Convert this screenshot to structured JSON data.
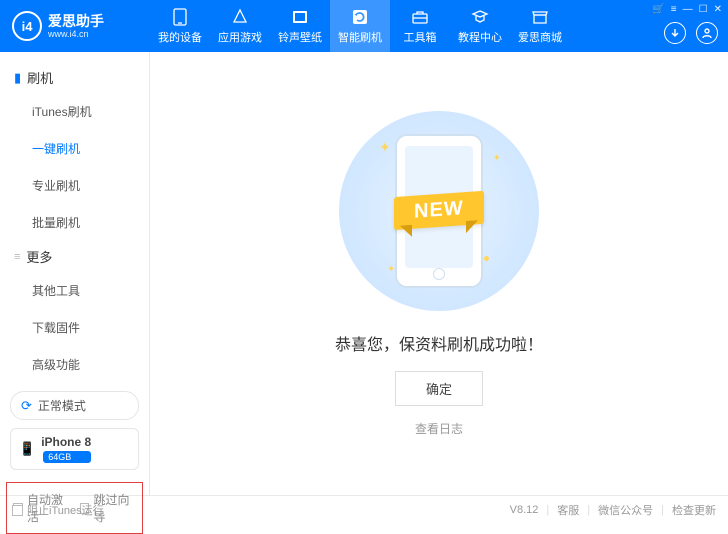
{
  "logo": {
    "badge": "i4",
    "title": "爱思助手",
    "subtitle": "www.i4.cn"
  },
  "nav": [
    {
      "label": "我的设备"
    },
    {
      "label": "应用游戏"
    },
    {
      "label": "铃声壁纸"
    },
    {
      "label": "智能刷机"
    },
    {
      "label": "工具箱"
    },
    {
      "label": "教程中心"
    },
    {
      "label": "爱思商城"
    }
  ],
  "sidebar": {
    "group1": {
      "title": "刷机",
      "items": [
        "iTunes刷机",
        "一键刷机",
        "专业刷机",
        "批量刷机"
      ]
    },
    "group2": {
      "title": "更多",
      "items": [
        "其他工具",
        "下载固件",
        "高级功能"
      ]
    },
    "mode": "正常模式",
    "device": {
      "name": "iPhone 8",
      "storage": "64GB"
    },
    "checks": [
      "自动激活",
      "跳过向导"
    ]
  },
  "main": {
    "ribbon": "NEW",
    "message": "恭喜您，保资料刷机成功啦！",
    "ok": "确定",
    "log": "查看日志"
  },
  "footer": {
    "block_itunes": "阻止iTunes运行",
    "version": "V8.12",
    "links": [
      "客服",
      "微信公众号",
      "检查更新"
    ]
  }
}
